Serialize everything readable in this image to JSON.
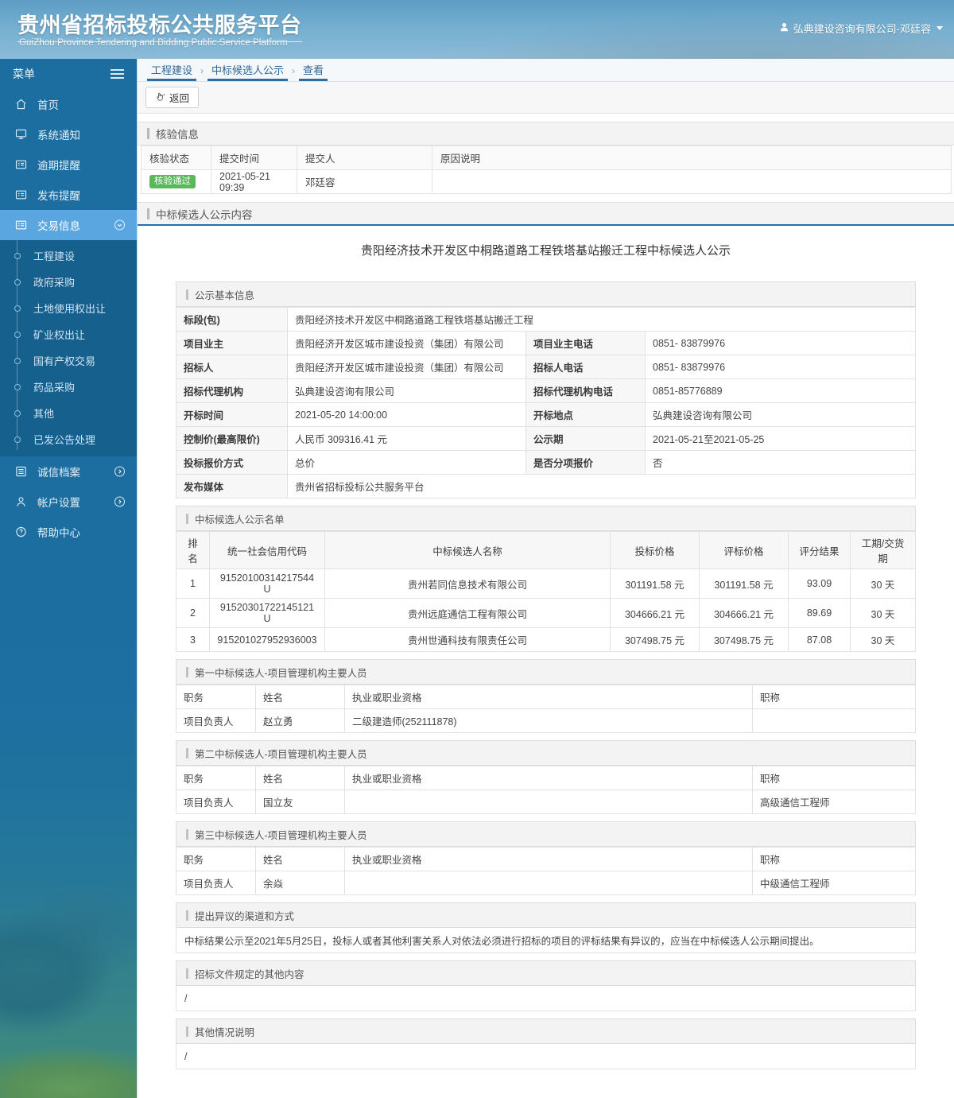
{
  "header": {
    "site_title": "贵州省招标投标公共服务平台",
    "site_subtitle": "GuiZhou Province Tendering and Bidding Public Service Platform",
    "user_label": "弘典建设咨询有限公司-邓廷容"
  },
  "sidebar": {
    "menu_label": "菜单",
    "items": [
      {
        "label": "首页",
        "icon": "home-icon",
        "active": false,
        "arrow": ""
      },
      {
        "label": "系统通知",
        "icon": "monitor-icon",
        "active": false,
        "arrow": ""
      },
      {
        "label": "逾期提醒",
        "icon": "folder-list-icon",
        "active": false,
        "arrow": ""
      },
      {
        "label": "发布提醒",
        "icon": "folder-list-icon",
        "active": false,
        "arrow": ""
      },
      {
        "label": "交易信息",
        "icon": "folder-list-icon",
        "active": true,
        "arrow": "down"
      }
    ],
    "submenu": [
      "工程建设",
      "政府采购",
      "土地使用权出让",
      "矿业权出让",
      "国有产权交易",
      "药品采购",
      "其他",
      "已发公告处理"
    ],
    "bottom_items": [
      {
        "label": "诚信档案",
        "icon": "list-icon",
        "arrow": "right"
      },
      {
        "label": "帐户设置",
        "icon": "user-icon",
        "arrow": "right"
      },
      {
        "label": "帮助中心",
        "icon": "question-icon",
        "arrow": ""
      }
    ]
  },
  "breadcrumb": [
    "工程建设",
    "中标候选人公示",
    "查看"
  ],
  "toolbar": {
    "back_label": "返回"
  },
  "verify": {
    "panel_title": "核验信息",
    "headers": [
      "核验状态",
      "提交时间",
      "提交人",
      "原因说明"
    ],
    "row": {
      "status": "核验通过",
      "submit_time": "2021-05-21 09:39",
      "submitter": "邓廷容",
      "reason": ""
    }
  },
  "announcement": {
    "panel_title": "中标候选人公示内容",
    "title": "贵阳经济技术开发区中桐路道路工程铁塔基站搬迁工程中标候选人公示",
    "basic_section": "公示基本信息",
    "basic_rows": [
      {
        "label": "标段(包)",
        "value": "贵阳经济技术开发区中桐路道路工程铁塔基站搬迁工程",
        "label2": "",
        "value2": "",
        "full": true
      },
      {
        "label": "项目业主",
        "value": "贵阳经济开发区城市建设投资（集团）有限公司",
        "label2": "项目业主电话",
        "value2": "0851- 83879976",
        "full": false
      },
      {
        "label": "招标人",
        "value": "贵阳经济开发区城市建设投资（集团）有限公司",
        "label2": "招标人电话",
        "value2": "0851- 83879976",
        "full": false
      },
      {
        "label": "招标代理机构",
        "value": "弘典建设咨询有限公司",
        "label2": "招标代理机构电话",
        "value2": "0851-85776889",
        "full": false
      },
      {
        "label": "开标时间",
        "value": "2021-05-20 14:00:00",
        "label2": "开标地点",
        "value2": "弘典建设咨询有限公司",
        "full": false
      },
      {
        "label": "控制价(最高限价)",
        "value": "人民币 309316.41 元",
        "label2": "公示期",
        "value2": "2021-05-21至2021-05-25",
        "full": false
      },
      {
        "label": "投标报价方式",
        "value": "总价",
        "label2": "是否分项报价",
        "value2": "否",
        "full": false
      },
      {
        "label": "发布媒体",
        "value": "贵州省招标投标公共服务平台",
        "label2": "",
        "value2": "",
        "full": true
      }
    ],
    "cand_section": "中标候选人公示名单",
    "cand_headers": [
      "排名",
      "统一社会信用代码",
      "中标候选人名称",
      "投标价格",
      "评标价格",
      "评分结果",
      "工期/交货期"
    ],
    "candidates": [
      {
        "rank": "1",
        "credit_code": "91520100314217544U",
        "name": "贵州若同信息技术有限公司",
        "bid_price": "301191.58 元",
        "eval_price": "301191.58 元",
        "score": "93.09",
        "duration": "30 天"
      },
      {
        "rank": "2",
        "credit_code": "91520301722145121U",
        "name": "贵州远庭通信工程有限公司",
        "bid_price": "304666.21 元",
        "eval_price": "304666.21 元",
        "score": "89.69",
        "duration": "30 天"
      },
      {
        "rank": "3",
        "credit_code": "915201027952936003",
        "name": "贵州世通科技有限责任公司",
        "bid_price": "307498.75 元",
        "eval_price": "307498.75 元",
        "score": "87.08",
        "duration": "30 天"
      }
    ],
    "personnel_headers": [
      "职务",
      "姓名",
      "执业或职业资格",
      "职称"
    ],
    "personnel_sections": [
      {
        "section": "第一中标候选人-项目管理机构主要人员",
        "rows": [
          {
            "duty": "项目负责人",
            "name": "赵立勇",
            "qualification": "二级建造师(252111878)",
            "title": ""
          }
        ]
      },
      {
        "section": "第二中标候选人-项目管理机构主要人员",
        "rows": [
          {
            "duty": "项目负责人",
            "name": "国立友",
            "qualification": "",
            "title": "高级通信工程师"
          }
        ]
      },
      {
        "section": "第三中标候选人-项目管理机构主要人员",
        "rows": [
          {
            "duty": "项目负责人",
            "name": "余焱",
            "qualification": "",
            "title": "中级通信工程师"
          }
        ]
      }
    ],
    "objection_section": "提出异议的渠道和方式",
    "objection_text": "中标结果公示至2021年5月25日，投标人或者其他利害关系人对依法必须进行招标的项目的评标结果有异议的，应当在中标候选人公示期间提出。",
    "other_doc_section": "招标文件规定的其他内容",
    "other_doc_text": "/",
    "other_info_section": "其他情况说明",
    "other_info_text": "/"
  }
}
